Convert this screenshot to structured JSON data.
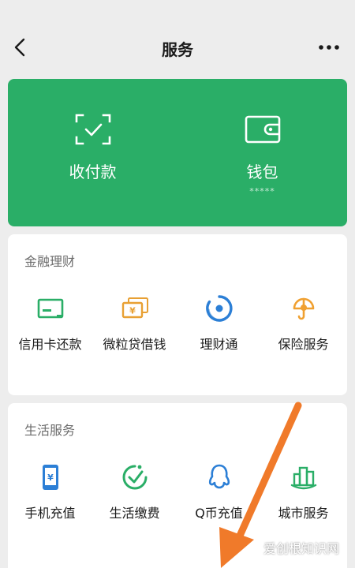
{
  "header": {
    "title": "服务"
  },
  "wallet_card": {
    "items": [
      {
        "label": "收付款",
        "icon": "scan-pay-icon"
      },
      {
        "label": "钱包",
        "icon": "wallet-icon",
        "sub": "*****"
      }
    ],
    "color": "#2aae67"
  },
  "finance": {
    "title": "金融理财",
    "items": [
      {
        "label": "信用卡还款",
        "icon": "credit-card-icon",
        "color": "#2aae67"
      },
      {
        "label": "微粒贷借钱",
        "icon": "loan-icon",
        "color": "#e8a033"
      },
      {
        "label": "理财通",
        "icon": "wealth-icon",
        "color": "#2c7fd6"
      },
      {
        "label": "保险服务",
        "icon": "insurance-icon",
        "color": "#f0a030"
      }
    ]
  },
  "life": {
    "title": "生活服务",
    "items": [
      {
        "label": "手机充值",
        "icon": "phone-recharge-icon",
        "color": "#2c7fd6"
      },
      {
        "label": "生活缴费",
        "icon": "bill-pay-icon",
        "color": "#2aae67"
      },
      {
        "label": "Q币充值",
        "icon": "qq-coin-icon",
        "color": "#2c7fd6"
      },
      {
        "label": "城市服务",
        "icon": "city-service-icon",
        "color": "#2aae67"
      }
    ]
  },
  "watermark": "爱创根知识网",
  "annotation_color": "#f07a2a"
}
